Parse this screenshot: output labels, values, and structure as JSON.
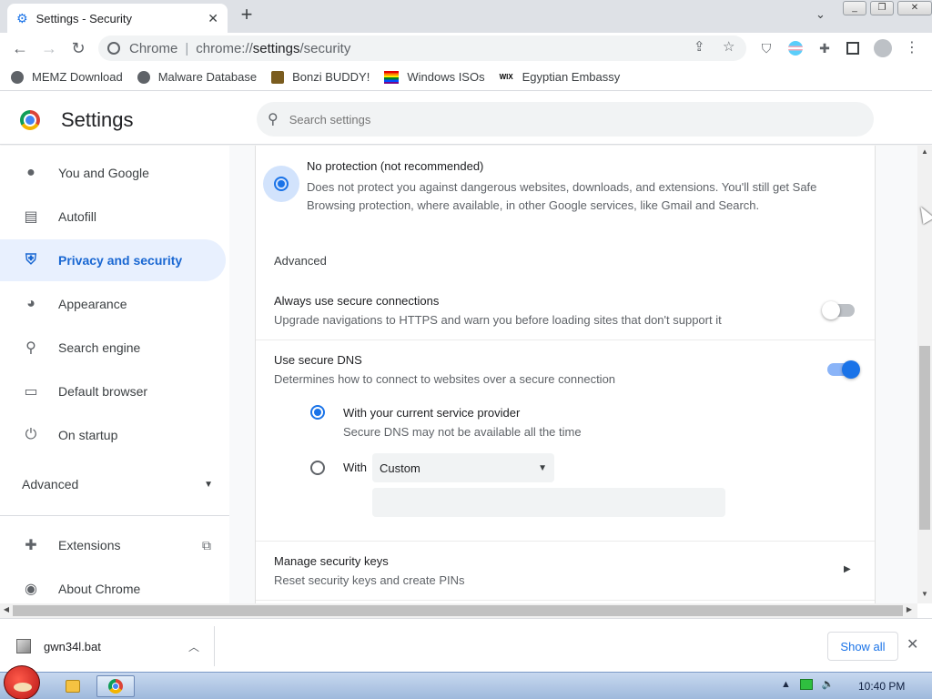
{
  "tab": {
    "title": "Settings - Security",
    "close": "✕"
  },
  "toolbar": {
    "scheme": "Chrome",
    "url_prefix": "chrome://",
    "url_path": "settings",
    "url_rest": "/security"
  },
  "bookmarks": [
    {
      "label": "MEMZ Download"
    },
    {
      "label": "Malware Database"
    },
    {
      "label": "Bonzi BUDDY!"
    },
    {
      "label": "Windows ISOs"
    },
    {
      "label": "Egyptian Embassy",
      "badge": "WIX"
    }
  ],
  "header": {
    "title": "Settings",
    "search_placeholder": "Search settings"
  },
  "sidebar": {
    "items": [
      {
        "label": "You and Google",
        "icon": "person-icon"
      },
      {
        "label": "Autofill",
        "icon": "clipboard-icon"
      },
      {
        "label": "Privacy and security",
        "icon": "shield-icon",
        "active": true
      },
      {
        "label": "Appearance",
        "icon": "palette-icon"
      },
      {
        "label": "Search engine",
        "icon": "search-icon"
      },
      {
        "label": "Default browser",
        "icon": "browser-icon"
      },
      {
        "label": "On startup",
        "icon": "power-icon"
      }
    ],
    "advanced": "Advanced",
    "extensions": "Extensions",
    "about": "About Chrome"
  },
  "main": {
    "no_protection": {
      "title": "No protection (not recommended)",
      "desc_line1": "Does not protect you against dangerous websites, downloads, and extensions. You'll still get Safe",
      "desc_line2": "Browsing protection, where available, in other Google services, like Gmail and Search."
    },
    "advanced_heading": "Advanced",
    "secure_connections": {
      "title": "Always use secure connections",
      "desc": "Upgrade navigations to HTTPS and warn you before loading sites that don't support it",
      "enabled": false
    },
    "secure_dns": {
      "title": "Use secure DNS",
      "desc": "Determines how to connect to websites over a secure connection",
      "enabled": true,
      "option_current": "With your current service provider",
      "option_current_desc": "Secure DNS may not be available all the time",
      "option_with": "With",
      "provider_selected": "Custom",
      "custom_value": ""
    },
    "security_keys": {
      "title": "Manage security keys",
      "desc": "Reset security keys and create PINs"
    }
  },
  "downloads": {
    "filename": "gwn34l.bat",
    "show_all": "Show all"
  },
  "taskbar": {
    "clock": "10:40 PM"
  }
}
